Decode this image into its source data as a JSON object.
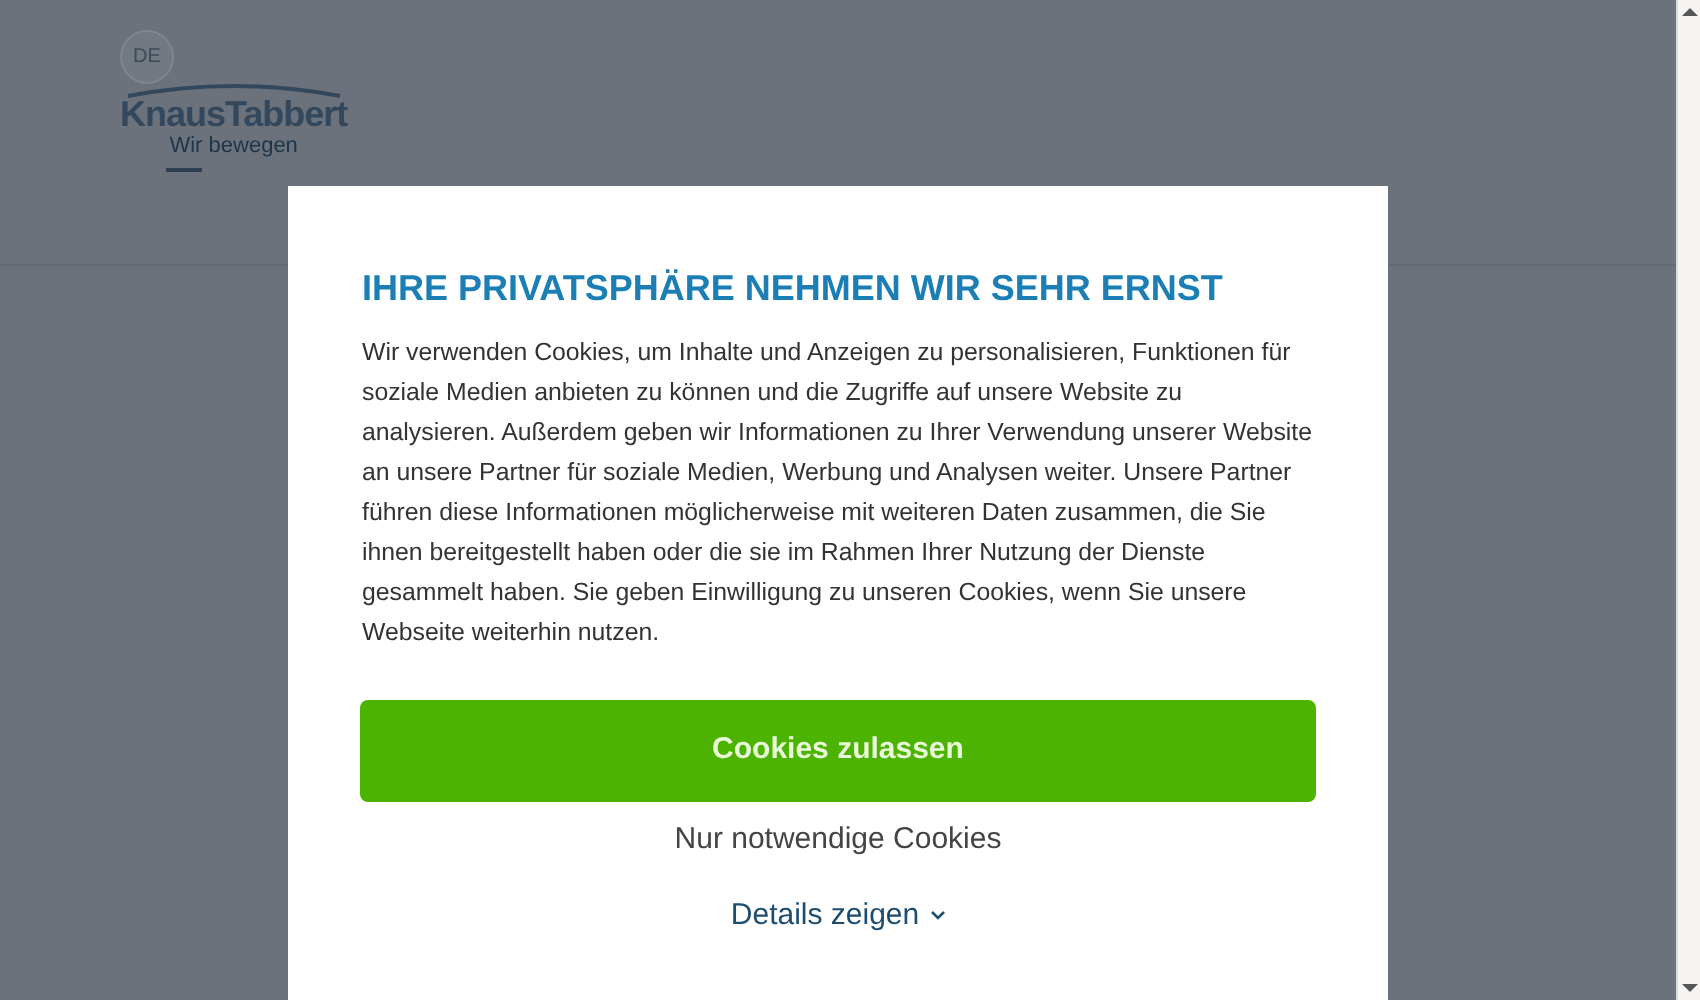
{
  "header": {
    "language": "DE",
    "logo": {
      "name": "KnausTabbert",
      "tagline": "Wir bewegen"
    }
  },
  "dialog": {
    "title": "IHRE PRIVATSPHÄRE NEHMEN WIR SEHR ERNST",
    "text": "Wir verwenden Cookies, um Inhalte und Anzeigen zu personalisieren, Funktionen für soziale Medien anbieten zu können und die Zugriffe auf unsere Website zu analysieren. Außerdem geben wir Informationen zu Ihrer Verwendung unserer Website an unsere Partner für soziale Medien, Werbung und Analysen weiter. Unsere Partner führen diese Informationen möglicherweise mit weiteren Daten zusammen, die Sie ihnen bereitgestellt haben oder die sie im Rahmen Ihrer Nutzung der Dienste gesammelt haben. Sie geben Einwilligung zu unseren Cookies, wenn Sie unsere Webseite weiterhin nutzen.",
    "accept_button": "Cookies zulassen",
    "necessary_button": "Nur notwendige Cookies",
    "details_link": {
      "label": "Details zeigen",
      "expanded": false
    }
  }
}
